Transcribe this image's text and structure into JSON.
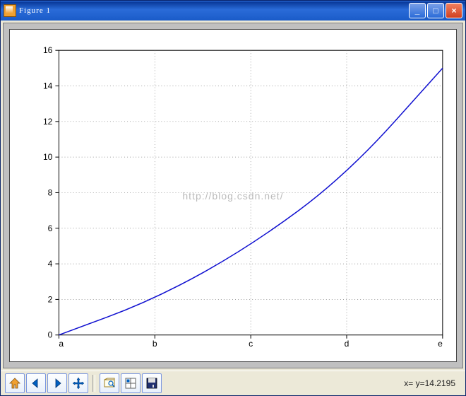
{
  "window": {
    "title": "Figure 1",
    "buttons": {
      "minimize": "_",
      "maximize": "□",
      "close": "×"
    }
  },
  "watermark": "http://blog.csdn.net/",
  "status": {
    "text": "x= y=14.2195"
  },
  "toolbar": {
    "home": "home-icon",
    "back": "back-icon",
    "forward": "forward-icon",
    "pan": "pan-icon",
    "zoom": "zoom-icon",
    "subplots": "subplots-icon",
    "save": "save-icon"
  },
  "chart_data": {
    "type": "line",
    "categories": [
      "a",
      "b",
      "c",
      "d",
      "e"
    ],
    "x_numeric": [
      0,
      1,
      2,
      3,
      4
    ],
    "series": [
      {
        "name": "",
        "values": [
          0,
          2,
          5,
          9,
          15
        ],
        "color": "#1010d0"
      }
    ],
    "title": "",
    "xlabel": "",
    "ylabel": "",
    "xlim": [
      0,
      4
    ],
    "ylim": [
      0,
      16
    ],
    "yticks": [
      0,
      2,
      4,
      6,
      8,
      10,
      12,
      14,
      16
    ],
    "grid": true,
    "grid_style": "dotted"
  }
}
